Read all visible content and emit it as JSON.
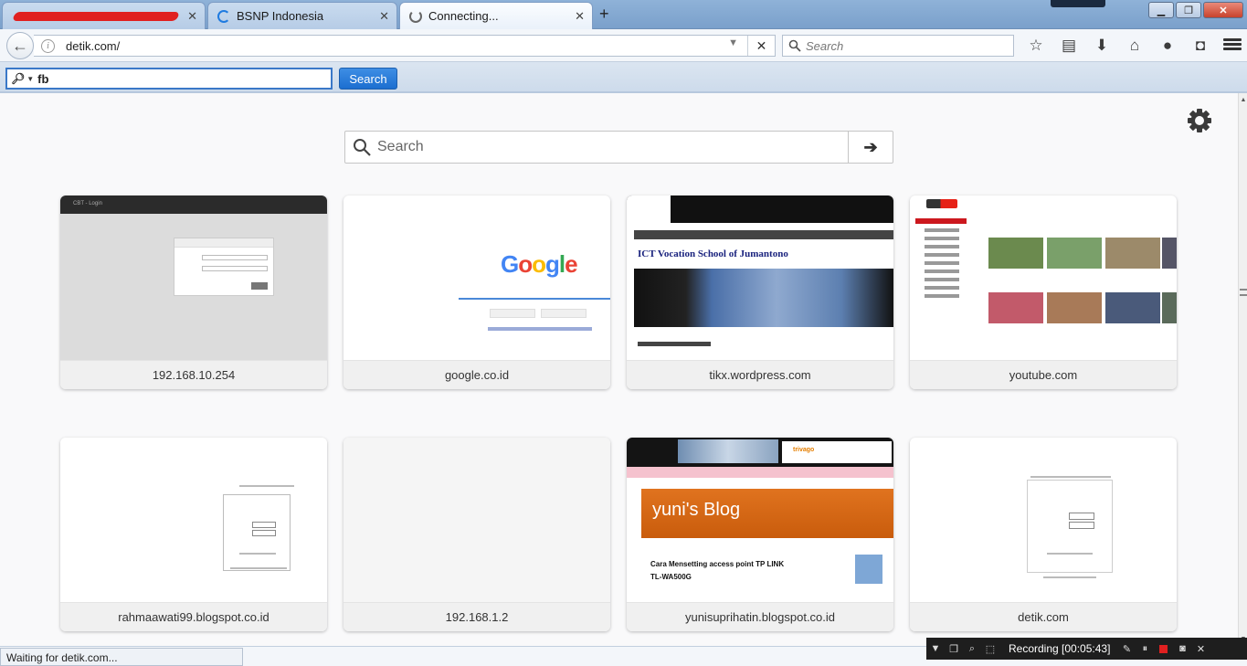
{
  "tabs": [
    {
      "title": "",
      "redacted": true
    },
    {
      "title": "BSNP Indonesia"
    },
    {
      "title": "Connecting...",
      "active": true
    }
  ],
  "urlbar": {
    "url": "detik.com/"
  },
  "searchbar": {
    "placeholder": "Search"
  },
  "findbar": {
    "query": "fb",
    "button_label": "Search"
  },
  "page_search": {
    "placeholder": "Search"
  },
  "tiles": [
    {
      "label": "192.168.10.254"
    },
    {
      "label": "google.co.id"
    },
    {
      "label": "tikx.wordpress.com"
    },
    {
      "label": "youtube.com"
    },
    {
      "label": "rahmaawati99.blogspot.co.id"
    },
    {
      "label": "192.168.1.2"
    },
    {
      "label": "yunisuprihatin.blogspot.co.id"
    },
    {
      "label": "detik.com"
    }
  ],
  "thumbs": {
    "google_logo": "Google",
    "wp_title": "ICT Vocation School of Jumantono",
    "yuni_blog_title": "yuni's Blog",
    "yuni_post_title": "Cara Mensetting access point TP LINK TL-WA500G",
    "trivago_ad": "trivago"
  },
  "status": {
    "text": "Waiting for detik.com..."
  },
  "recorder": {
    "text": "Recording [00:05:43]"
  },
  "colors": {
    "accent": "#1c6ed0",
    "recording": "#e02020"
  }
}
